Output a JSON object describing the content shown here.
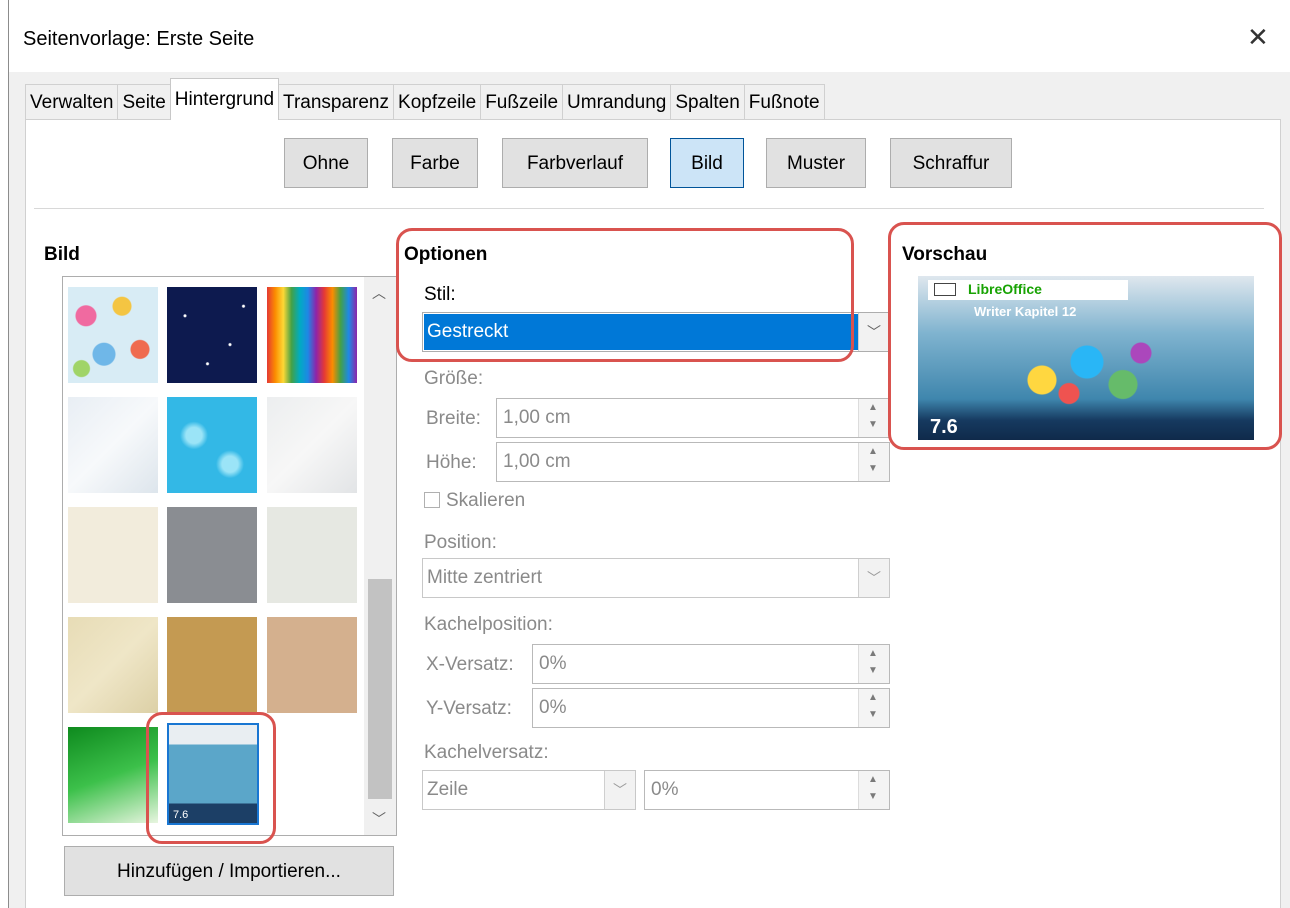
{
  "window": {
    "title": "Seitenvorlage: Erste Seite"
  },
  "tabs": [
    {
      "label": "Verwalten"
    },
    {
      "label": "Seite"
    },
    {
      "label": "Hintergrund"
    },
    {
      "label": "Transparenz"
    },
    {
      "label": "Kopfzeile"
    },
    {
      "label": "Fußzeile"
    },
    {
      "label": "Umrandung"
    },
    {
      "label": "Spalten"
    },
    {
      "label": "Fußnote"
    }
  ],
  "active_tab": "Hintergrund",
  "type_buttons": [
    {
      "label": "Ohne"
    },
    {
      "label": "Farbe"
    },
    {
      "label": "Farbverlauf"
    },
    {
      "label": "Bild",
      "selected": true
    },
    {
      "label": "Muster"
    },
    {
      "label": "Schraffur"
    }
  ],
  "bild": {
    "heading": "Bild",
    "add_button": "Hinzufügen / Importieren...",
    "selected_thumb_caption": "7.6"
  },
  "options": {
    "heading": "Optionen",
    "stil_label": "Stil:",
    "stil_value": "Gestreckt",
    "groesse_label": "Größe:",
    "breite_label": "Breite:",
    "breite_value": "1,00 cm",
    "hoehe_label": "Höhe:",
    "hoehe_value": "1,00 cm",
    "skalieren_label": "Skalieren",
    "position_label": "Position:",
    "position_value": "Mitte zentriert",
    "kachelposition_label": "Kachelposition:",
    "x_versatz_label": "X-Versatz:",
    "x_versatz_value": "0%",
    "y_versatz_label": "Y-Versatz:",
    "y_versatz_value": "0%",
    "kachelversatz_label": "Kachelversatz:",
    "kachelversatz_mode": "Zeile",
    "kachelversatz_value": "0%"
  },
  "preview": {
    "heading": "Vorschau",
    "brand": "LibreOffice",
    "subtitle": "Writer Kapitel 12",
    "version": "7.6"
  },
  "colors": {
    "highlight": "#d9534f",
    "selection": "#0078d7",
    "selected_button": "#cce4f7"
  }
}
